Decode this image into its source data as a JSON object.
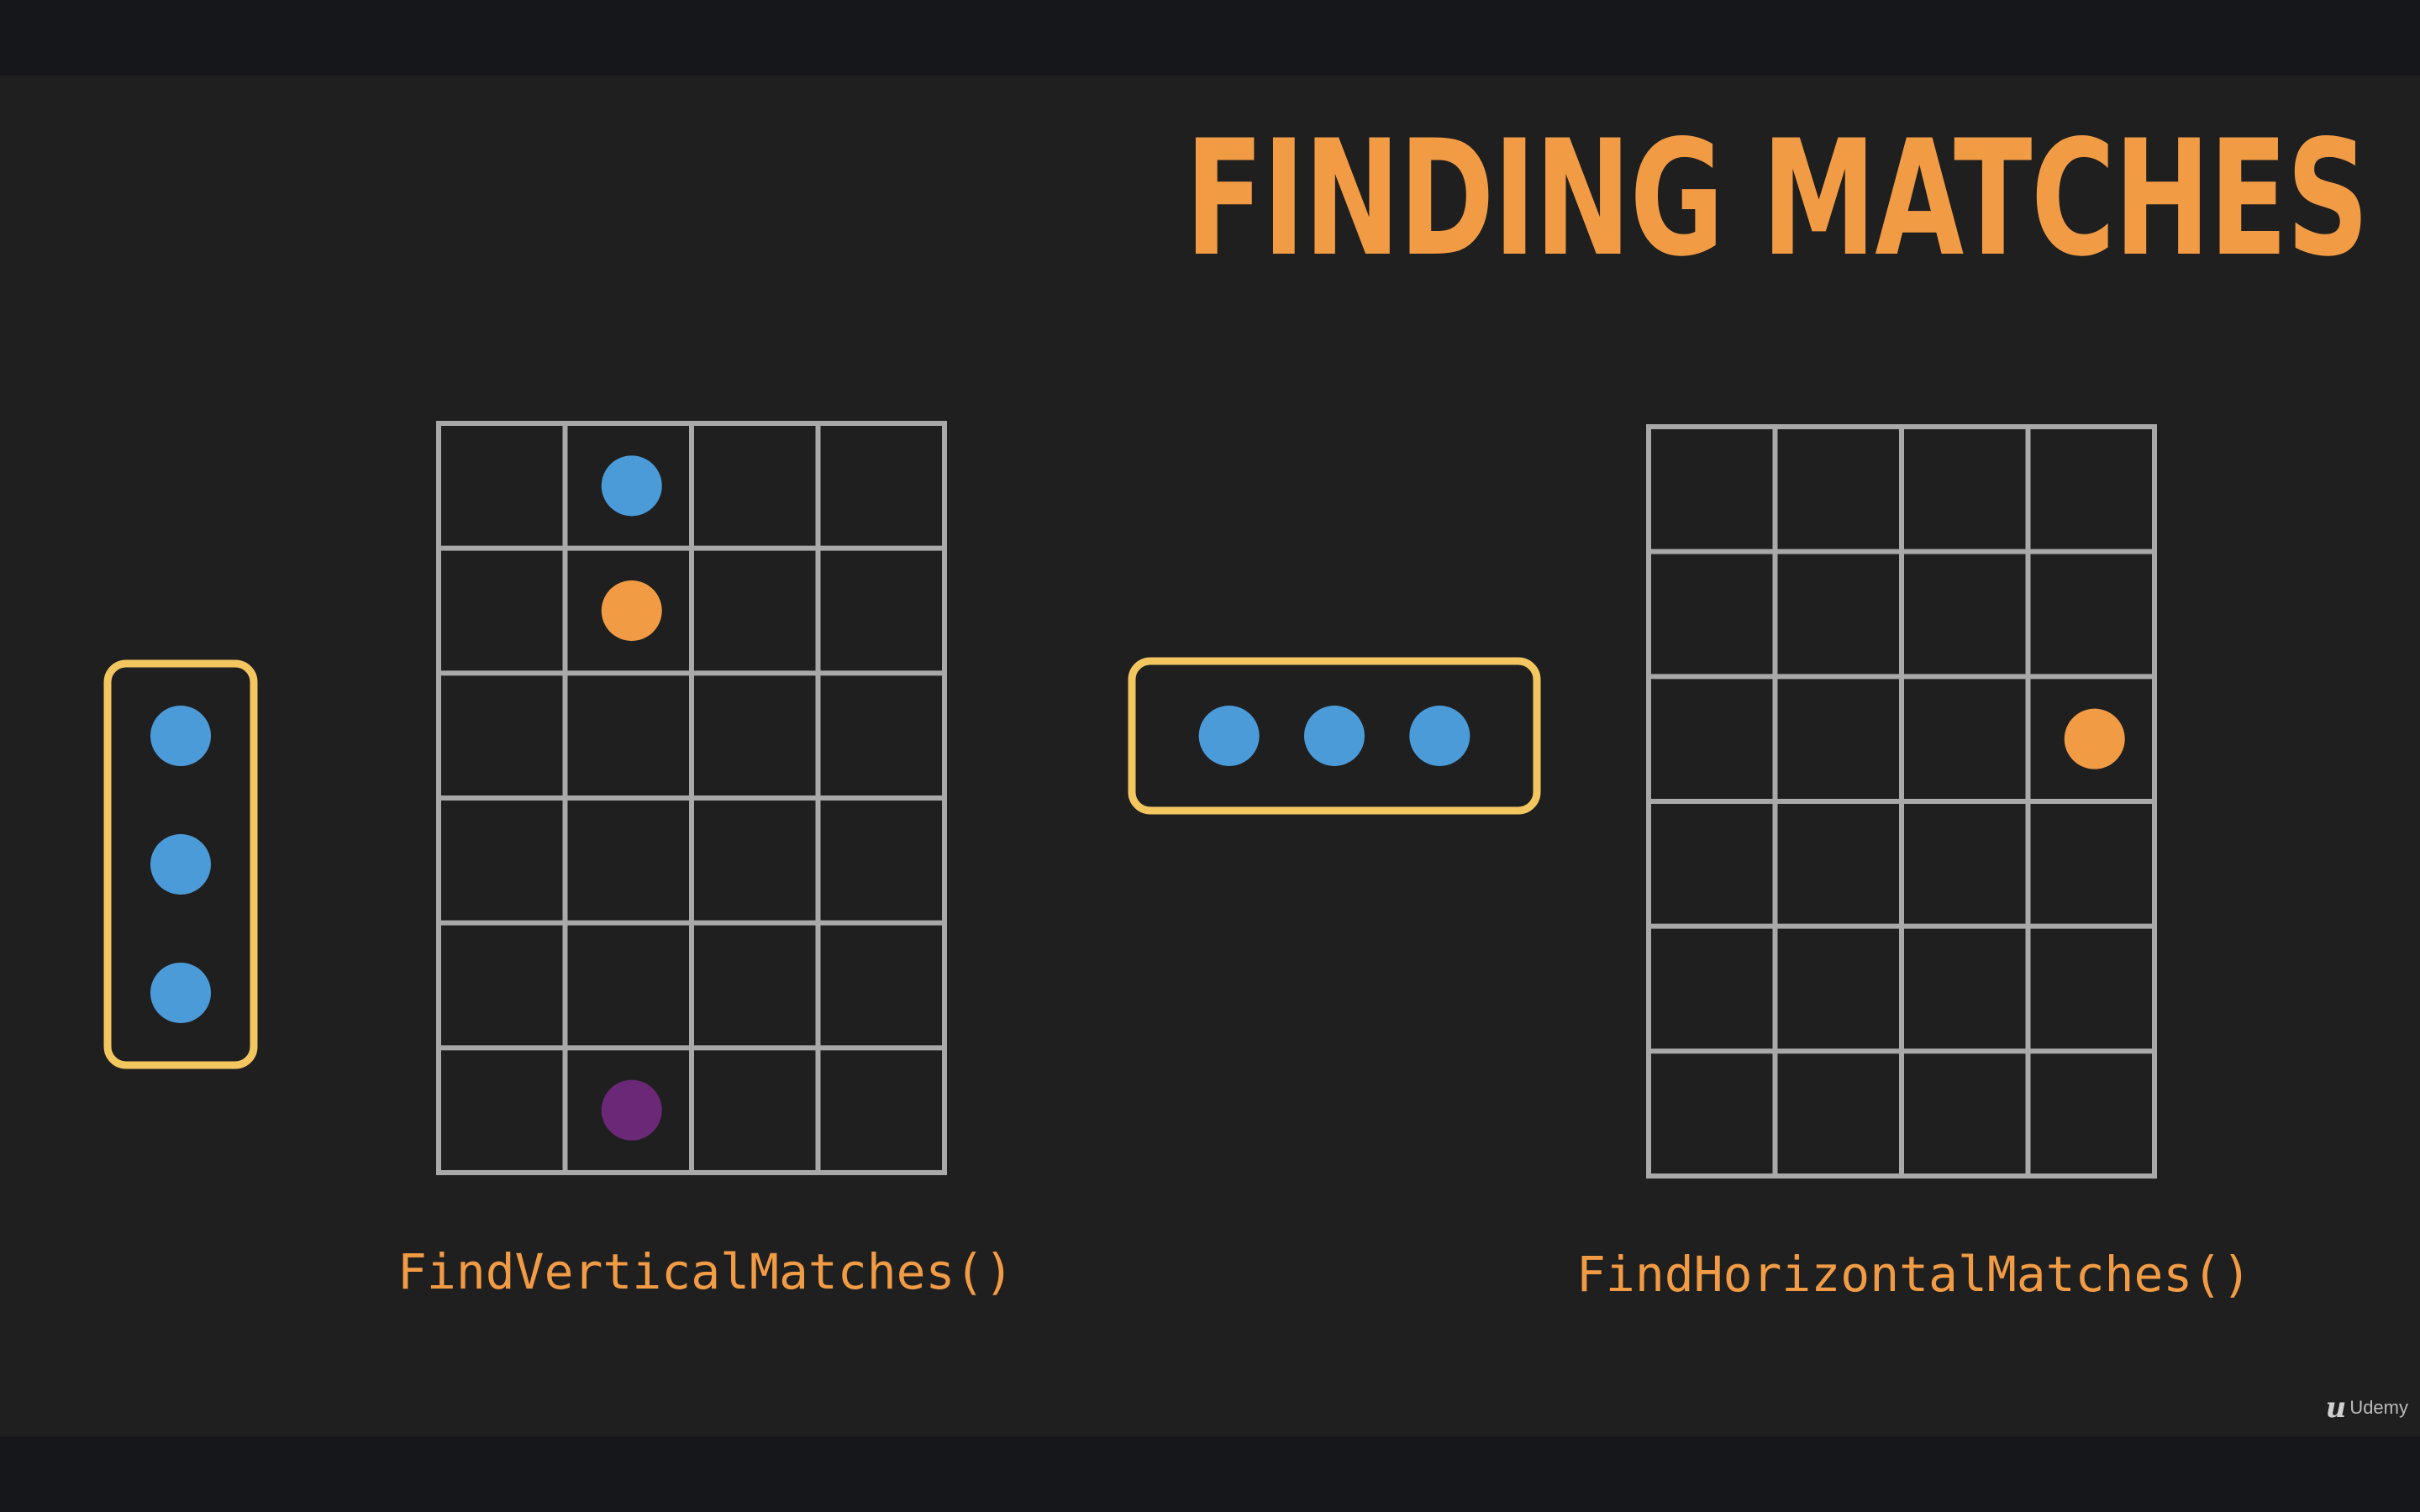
{
  "title": "FINDING MATCHES",
  "captions": {
    "vertical": "FindVerticalMatches()",
    "horizontal": "FindHorizontalMatches()"
  },
  "watermark": {
    "logo_glyph": "u",
    "text": "Udemy"
  },
  "colors": {
    "title": "#f29b45",
    "caption": "#f29b45",
    "grid": "#a9a9a9",
    "highlight": "#f4c660",
    "blue": "#4b9bd8",
    "orange": "#f29b45",
    "purple": "#6b2877"
  },
  "grids": [
    {
      "id": "vertical-board",
      "columns": 4,
      "rows": 6,
      "pieces": [
        {
          "column": 2,
          "row": 1,
          "color": "blue"
        },
        {
          "column": 2,
          "row": 2,
          "color": "orange"
        },
        {
          "column": 2,
          "row": 6,
          "color": "purple"
        }
      ]
    },
    {
      "id": "horizontal-board",
      "columns": 4,
      "rows": 6,
      "pieces": [
        {
          "column": 4,
          "row": 3,
          "color": "orange"
        }
      ]
    }
  ],
  "match_groups": [
    {
      "id": "vertical-match",
      "orientation": "vertical",
      "count": 3,
      "color": "blue"
    },
    {
      "id": "horizontal-match",
      "orientation": "horizontal",
      "count": 3,
      "color": "blue"
    }
  ]
}
